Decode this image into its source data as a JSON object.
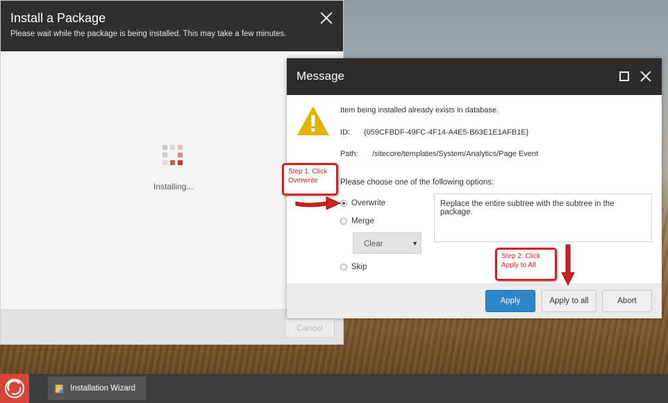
{
  "install_dialog": {
    "title": "Install a Package",
    "subtitle": "Please wait while the package is being installed. This may take a few minutes.",
    "status": "Installing...",
    "cancel_label": "Cancel"
  },
  "message_dialog": {
    "title": "Message",
    "line1": "Item being installed already exists in database.",
    "id_label": "ID:",
    "id_value": "{059CFBDF-49FC-4F14-A4E5-B63E1E1AFB1E}",
    "path_label": "Path:",
    "path_value": "/sitecore/templates/System/Analytics/Page Event",
    "choose_text": "Please choose one of the following options:",
    "options": [
      {
        "label": "Overwrite",
        "selected": true
      },
      {
        "label": "Merge",
        "selected": false
      },
      {
        "label": "Skip",
        "selected": false
      }
    ],
    "merge_select_value": "Clear",
    "description": "Replace the entire subtree with the subtree in the package.",
    "buttons": {
      "apply": "Apply",
      "apply_all": "Apply to all",
      "abort": "Abort"
    }
  },
  "callouts": {
    "step1": "Step 1: Click Overwrite",
    "step2": "Step 2: Click Apply to All"
  },
  "taskbar": {
    "task_label": "Installation Wizard"
  },
  "colors": {
    "accent_red": "#d31f1f",
    "apply_blue": "#2c86c8",
    "warning_yellow": "#e0b400",
    "header_dark": "#2b2b2b"
  },
  "icons": [
    "close-icon",
    "maximize-icon",
    "warning-icon",
    "spinner-icon",
    "chevron-down-icon",
    "sitecore-logo-icon",
    "package-icon"
  ]
}
